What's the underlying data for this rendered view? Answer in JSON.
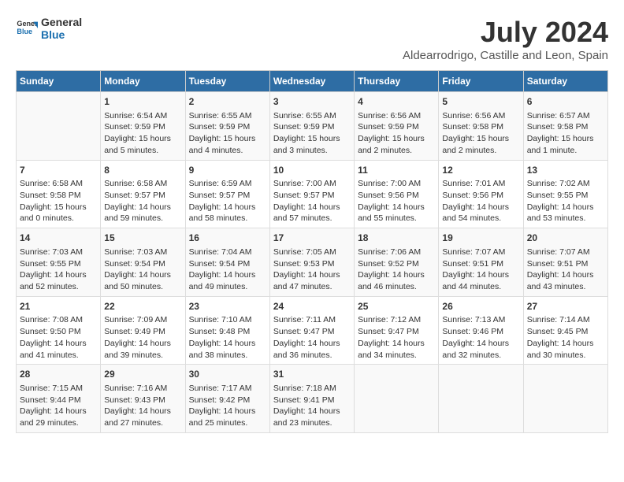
{
  "logo": {
    "line1": "General",
    "line2": "Blue"
  },
  "title": "July 2024",
  "subtitle": "Aldearrodrigo, Castille and Leon, Spain",
  "days_of_week": [
    "Sunday",
    "Monday",
    "Tuesday",
    "Wednesday",
    "Thursday",
    "Friday",
    "Saturday"
  ],
  "weeks": [
    [
      {
        "day": "",
        "content": ""
      },
      {
        "day": "1",
        "content": "Sunrise: 6:54 AM\nSunset: 9:59 PM\nDaylight: 15 hours\nand 5 minutes."
      },
      {
        "day": "2",
        "content": "Sunrise: 6:55 AM\nSunset: 9:59 PM\nDaylight: 15 hours\nand 4 minutes."
      },
      {
        "day": "3",
        "content": "Sunrise: 6:55 AM\nSunset: 9:59 PM\nDaylight: 15 hours\nand 3 minutes."
      },
      {
        "day": "4",
        "content": "Sunrise: 6:56 AM\nSunset: 9:59 PM\nDaylight: 15 hours\nand 2 minutes."
      },
      {
        "day": "5",
        "content": "Sunrise: 6:56 AM\nSunset: 9:58 PM\nDaylight: 15 hours\nand 2 minutes."
      },
      {
        "day": "6",
        "content": "Sunrise: 6:57 AM\nSunset: 9:58 PM\nDaylight: 15 hours\nand 1 minute."
      }
    ],
    [
      {
        "day": "7",
        "content": "Sunrise: 6:58 AM\nSunset: 9:58 PM\nDaylight: 15 hours\nand 0 minutes."
      },
      {
        "day": "8",
        "content": "Sunrise: 6:58 AM\nSunset: 9:57 PM\nDaylight: 14 hours\nand 59 minutes."
      },
      {
        "day": "9",
        "content": "Sunrise: 6:59 AM\nSunset: 9:57 PM\nDaylight: 14 hours\nand 58 minutes."
      },
      {
        "day": "10",
        "content": "Sunrise: 7:00 AM\nSunset: 9:57 PM\nDaylight: 14 hours\nand 57 minutes."
      },
      {
        "day": "11",
        "content": "Sunrise: 7:00 AM\nSunset: 9:56 PM\nDaylight: 14 hours\nand 55 minutes."
      },
      {
        "day": "12",
        "content": "Sunrise: 7:01 AM\nSunset: 9:56 PM\nDaylight: 14 hours\nand 54 minutes."
      },
      {
        "day": "13",
        "content": "Sunrise: 7:02 AM\nSunset: 9:55 PM\nDaylight: 14 hours\nand 53 minutes."
      }
    ],
    [
      {
        "day": "14",
        "content": "Sunrise: 7:03 AM\nSunset: 9:55 PM\nDaylight: 14 hours\nand 52 minutes."
      },
      {
        "day": "15",
        "content": "Sunrise: 7:03 AM\nSunset: 9:54 PM\nDaylight: 14 hours\nand 50 minutes."
      },
      {
        "day": "16",
        "content": "Sunrise: 7:04 AM\nSunset: 9:54 PM\nDaylight: 14 hours\nand 49 minutes."
      },
      {
        "day": "17",
        "content": "Sunrise: 7:05 AM\nSunset: 9:53 PM\nDaylight: 14 hours\nand 47 minutes."
      },
      {
        "day": "18",
        "content": "Sunrise: 7:06 AM\nSunset: 9:52 PM\nDaylight: 14 hours\nand 46 minutes."
      },
      {
        "day": "19",
        "content": "Sunrise: 7:07 AM\nSunset: 9:51 PM\nDaylight: 14 hours\nand 44 minutes."
      },
      {
        "day": "20",
        "content": "Sunrise: 7:07 AM\nSunset: 9:51 PM\nDaylight: 14 hours\nand 43 minutes."
      }
    ],
    [
      {
        "day": "21",
        "content": "Sunrise: 7:08 AM\nSunset: 9:50 PM\nDaylight: 14 hours\nand 41 minutes."
      },
      {
        "day": "22",
        "content": "Sunrise: 7:09 AM\nSunset: 9:49 PM\nDaylight: 14 hours\nand 39 minutes."
      },
      {
        "day": "23",
        "content": "Sunrise: 7:10 AM\nSunset: 9:48 PM\nDaylight: 14 hours\nand 38 minutes."
      },
      {
        "day": "24",
        "content": "Sunrise: 7:11 AM\nSunset: 9:47 PM\nDaylight: 14 hours\nand 36 minutes."
      },
      {
        "day": "25",
        "content": "Sunrise: 7:12 AM\nSunset: 9:47 PM\nDaylight: 14 hours\nand 34 minutes."
      },
      {
        "day": "26",
        "content": "Sunrise: 7:13 AM\nSunset: 9:46 PM\nDaylight: 14 hours\nand 32 minutes."
      },
      {
        "day": "27",
        "content": "Sunrise: 7:14 AM\nSunset: 9:45 PM\nDaylight: 14 hours\nand 30 minutes."
      }
    ],
    [
      {
        "day": "28",
        "content": "Sunrise: 7:15 AM\nSunset: 9:44 PM\nDaylight: 14 hours\nand 29 minutes."
      },
      {
        "day": "29",
        "content": "Sunrise: 7:16 AM\nSunset: 9:43 PM\nDaylight: 14 hours\nand 27 minutes."
      },
      {
        "day": "30",
        "content": "Sunrise: 7:17 AM\nSunset: 9:42 PM\nDaylight: 14 hours\nand 25 minutes."
      },
      {
        "day": "31",
        "content": "Sunrise: 7:18 AM\nSunset: 9:41 PM\nDaylight: 14 hours\nand 23 minutes."
      },
      {
        "day": "",
        "content": ""
      },
      {
        "day": "",
        "content": ""
      },
      {
        "day": "",
        "content": ""
      }
    ]
  ]
}
